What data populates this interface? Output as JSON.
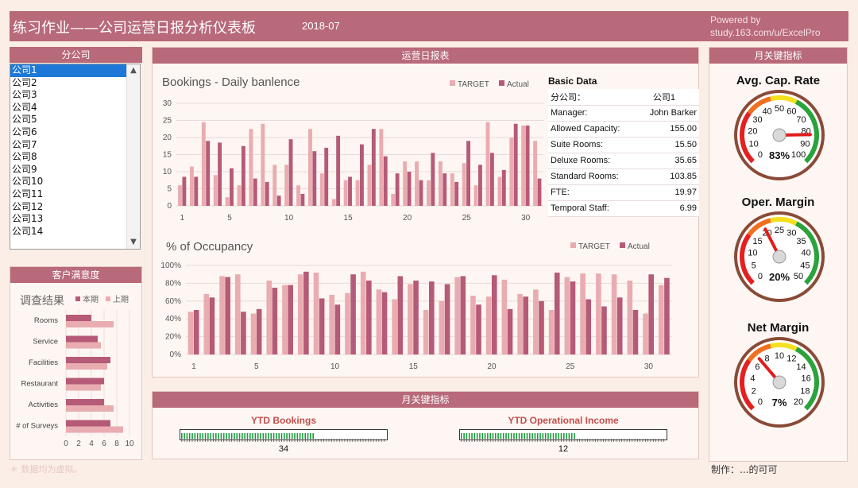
{
  "header": {
    "title": "练习作业——公司运营日报分析仪表板",
    "date": "2018-07",
    "credit_line1": "Powered by",
    "credit_line2": "study.163.com/u/ExcelPro"
  },
  "branches": {
    "heading": "分公司",
    "items": [
      "公司1",
      "公司2",
      "公司3",
      "公司4",
      "公司5",
      "公司6",
      "公司7",
      "公司8",
      "公司9",
      "公司10",
      "公司11",
      "公司12",
      "公司13",
      "公司14"
    ],
    "selected": "公司1"
  },
  "satisfaction": {
    "heading": "客户满意度"
  },
  "daily": {
    "heading": "运营日报表"
  },
  "basic_data": {
    "title": "Basic Data",
    "rows": [
      {
        "label": "分公司：",
        "value": "公司1"
      },
      {
        "label": "Manager:",
        "value": "John Barker"
      },
      {
        "label": "Allowed Capacity:",
        "value": "155.00"
      },
      {
        "label": "Suite Rooms:",
        "value": "15.50"
      },
      {
        "label": "Deluxe Rooms:",
        "value": "35.65"
      },
      {
        "label": "Standard Rooms:",
        "value": "103.85"
      },
      {
        "label": "FTE:",
        "value": "19.97"
      },
      {
        "label": "Temporal Staff:",
        "value": "6.99"
      }
    ]
  },
  "monthly_kpi": {
    "heading": "月关键指标",
    "gauges": [
      {
        "title": "Avg. Cap. Rate",
        "min": 0,
        "max": 100,
        "value": 83,
        "display": "83%",
        "ticks": [
          0,
          10,
          20,
          30,
          40,
          50,
          60,
          70,
          80,
          90,
          100
        ]
      },
      {
        "title": "Oper. Margin",
        "min": 0,
        "max": 50,
        "value": 20,
        "display": "20%",
        "ticks": [
          0,
          5,
          10,
          15,
          20,
          25,
          30,
          35,
          40,
          45,
          50
        ]
      },
      {
        "title": "Net Margin",
        "min": 0,
        "max": 20,
        "value": 7,
        "display": "7%",
        "ticks": [
          0,
          2,
          4,
          6,
          8,
          10,
          12,
          14,
          16,
          18,
          20
        ]
      }
    ]
  },
  "ytd": {
    "heading": "月关键指标",
    "bookings_label": "YTD Bookings",
    "bookings_value": "34",
    "bookings_fill": 0.65,
    "income_label": "YTD Operational Income",
    "income_value": "12",
    "income_fill": 0.57
  },
  "footer": {
    "note": "＊ 数据均为虚拟。",
    "maker": "制作：...的可可"
  },
  "colors": {
    "target": "#e9acb0",
    "actual": "#b55a77",
    "header": "#b8697a",
    "accent": "#1e78d7"
  },
  "chart_data": [
    {
      "type": "bar",
      "title": "Bookings - Daily banlence",
      "series_names": [
        "TARGET",
        "Actual"
      ],
      "ylim": [
        0,
        30
      ],
      "yticks": [
        0,
        5,
        10,
        15,
        20,
        25,
        30
      ],
      "xtick_labels": [
        "1",
        "5",
        "10",
        "15",
        "20",
        "25",
        "30"
      ],
      "x": [
        1,
        2,
        3,
        4,
        5,
        6,
        7,
        8,
        9,
        10,
        11,
        12,
        13,
        14,
        15,
        16,
        17,
        18,
        19,
        20,
        21,
        22,
        23,
        24,
        25,
        26,
        27,
        28,
        29,
        30,
        31
      ],
      "series": [
        {
          "name": "TARGET",
          "values": [
            6,
            11.5,
            24.5,
            9,
            2.5,
            6,
            22.5,
            24,
            12,
            12,
            6,
            22.5,
            9.5,
            2,
            7.5,
            7.5,
            12,
            22.5,
            3.5,
            13,
            13,
            7.5,
            13,
            9.5,
            12.5,
            6,
            24.5,
            8.5,
            20,
            23.5,
            19
          ]
        },
        {
          "name": "Actual",
          "values": [
            8.5,
            8.5,
            19,
            18.5,
            11,
            17.5,
            8,
            7,
            3,
            19.5,
            3.5,
            16,
            17,
            20.5,
            8.5,
            18,
            22.5,
            14.5,
            9.5,
            10,
            7.5,
            15.5,
            9.5,
            7,
            19,
            12,
            15.5,
            10.5,
            24,
            23.5,
            8
          ]
        }
      ]
    },
    {
      "type": "bar",
      "title": "% of Occupancy",
      "series_names": [
        "TARGET",
        "Actual"
      ],
      "ylim": [
        0,
        100
      ],
      "yticks": [
        "0%",
        "20%",
        "40%",
        "60%",
        "80%",
        "100%"
      ],
      "xtick_labels": [
        "1",
        "5",
        "10",
        "15",
        "20",
        "25",
        "30"
      ],
      "x": [
        1,
        2,
        3,
        4,
        5,
        6,
        7,
        8,
        9,
        10,
        11,
        12,
        13,
        14,
        15,
        16,
        17,
        18,
        19,
        20,
        21,
        22,
        23,
        24,
        25,
        26,
        27,
        28,
        29,
        30,
        31
      ],
      "series": [
        {
          "name": "TARGET",
          "values": [
            48,
            68,
            88,
            90,
            46,
            83,
            78,
            90,
            92,
            67,
            69,
            93,
            73,
            62,
            79,
            50,
            60,
            87,
            66,
            65,
            84,
            68,
            73,
            50,
            87,
            91,
            91,
            90,
            83,
            46,
            78
          ]
        },
        {
          "name": "Actual",
          "values": [
            50,
            64,
            87,
            48,
            51,
            75,
            78,
            93,
            63,
            56,
            90,
            83,
            70,
            88,
            83,
            82,
            79,
            88,
            56,
            89,
            51,
            65,
            60,
            92,
            82,
            62,
            54,
            64,
            50,
            90,
            86
          ]
        }
      ]
    },
    {
      "type": "bar",
      "orientation": "horizontal",
      "title": "调查结果",
      "series_names": [
        "本期",
        "上期"
      ],
      "categories": [
        "Rooms",
        "Service",
        "Facilities",
        "Restaurant",
        "Activities",
        "# of Surveys"
      ],
      "xlim": [
        0,
        10
      ],
      "xticks": [
        0,
        2,
        4,
        6,
        8,
        10
      ],
      "series": [
        {
          "name": "本期",
          "values": [
            4,
            5,
            7,
            6,
            6,
            7
          ]
        },
        {
          "name": "上期",
          "values": [
            7.5,
            5.5,
            6.5,
            5.5,
            7.5,
            9
          ]
        }
      ]
    }
  ]
}
